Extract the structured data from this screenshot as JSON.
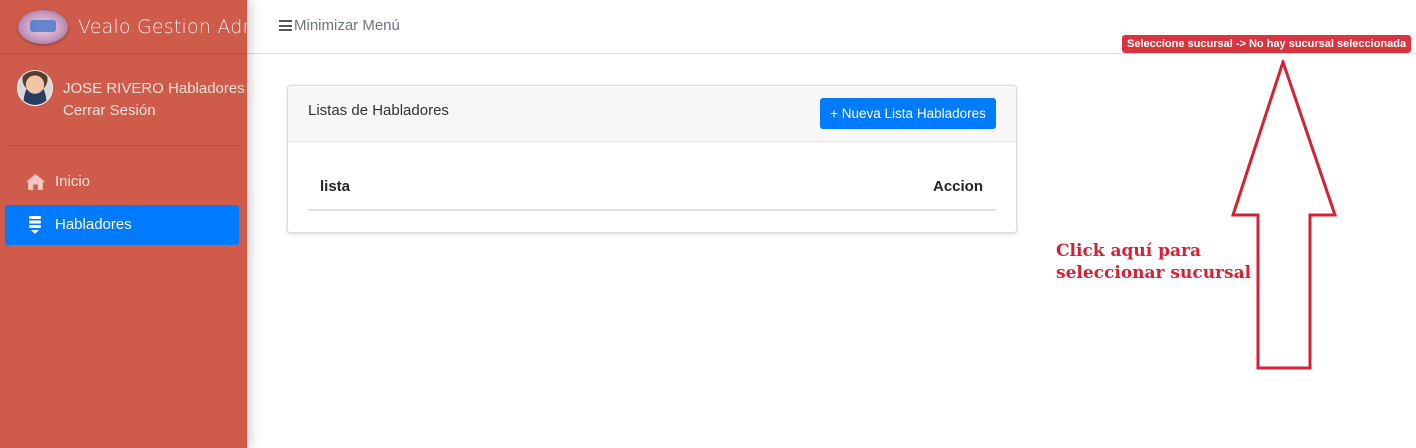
{
  "app": {
    "title": "Vealo Gestion Admin"
  },
  "user": {
    "name": "JOSE RIVERO Habladores",
    "logout_label": "Cerrar Sesión"
  },
  "sidebar": {
    "items": [
      {
        "label": "Inicio",
        "icon": "home-icon",
        "active": false
      },
      {
        "label": "Habladores",
        "icon": "list-icon",
        "active": true
      }
    ]
  },
  "topbar": {
    "minimize_label": "Minimizar Menú",
    "branch_badge": "Seleccione sucursal -> No hay sucursal seleccionada"
  },
  "card": {
    "title": "Listas de Habladores",
    "new_button_label": "+ Nueva Lista Habladores",
    "table": {
      "columns": [
        "lista",
        "Accion"
      ],
      "rows": []
    }
  },
  "annotation": {
    "line1": "Click aquí para",
    "line2": "seleccionar sucursal",
    "color": "#d62033"
  },
  "colors": {
    "sidebar_bg": "#cf5c4a",
    "primary": "#007bff",
    "badge": "#d9343f"
  }
}
